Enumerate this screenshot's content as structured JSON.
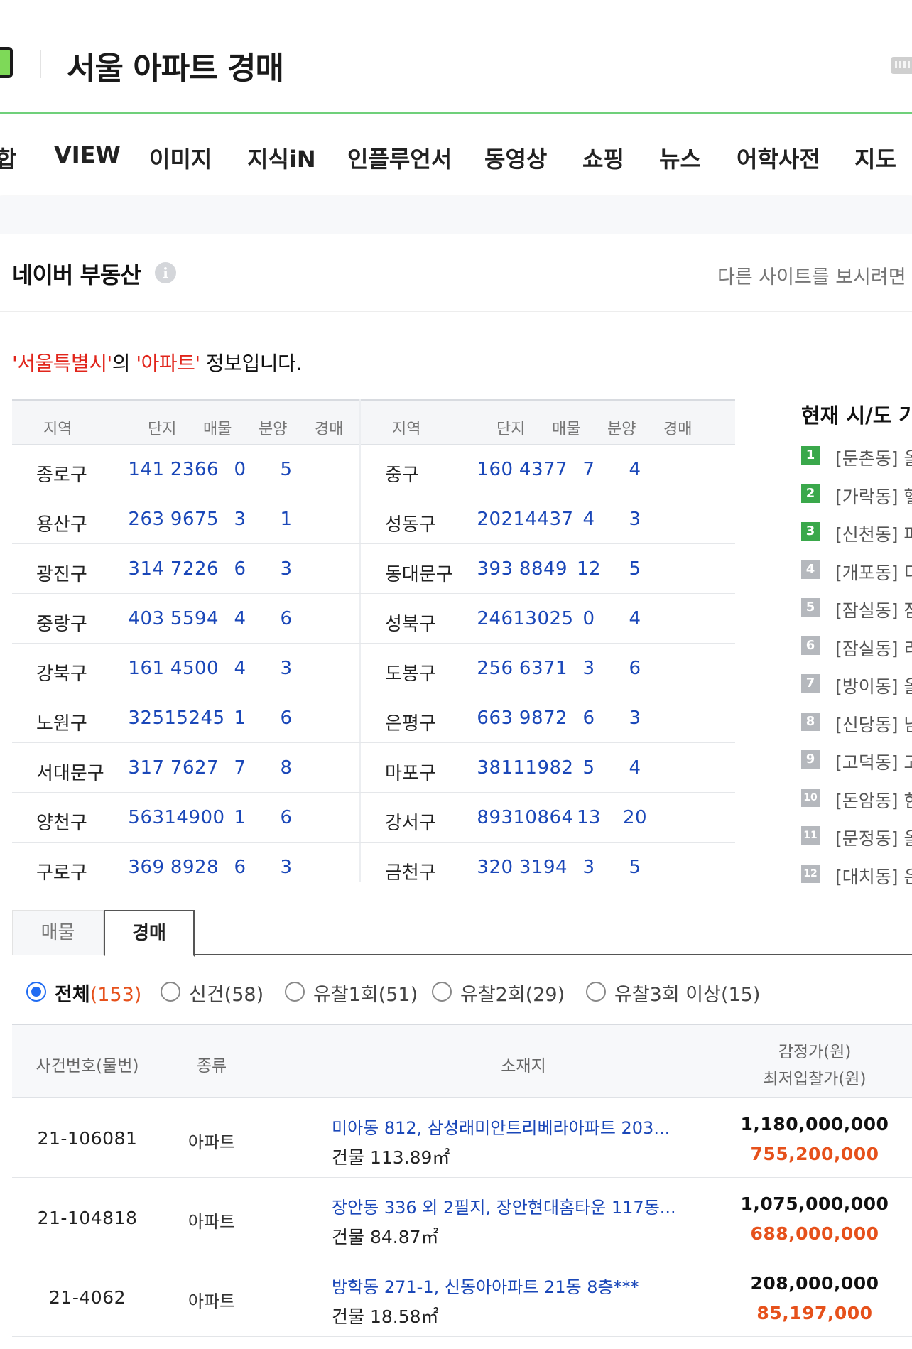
{
  "header": {
    "query": "서울 아파트 경매"
  },
  "tabs": [
    "합",
    "VIEW",
    "이미지",
    "지식iN",
    "인플루언서",
    "동영상",
    "쇼핑",
    "뉴스",
    "어학사전",
    "지도"
  ],
  "section": {
    "title": "네이버 부동산",
    "info": "i",
    "right_hint": "다른 사이트를 보시려면 클"
  },
  "intro": {
    "city": "'서울특별시'",
    "mid": "의 ",
    "type": "'아파트'",
    "tail": " 정보입니다."
  },
  "region_table": {
    "headers": [
      "지역",
      "단지",
      "매물",
      "분양",
      "경매"
    ],
    "rows": [
      [
        [
          "종로구",
          "141",
          "2366",
          "0",
          "5"
        ],
        [
          "중구",
          "160",
          "4377",
          "7",
          "4"
        ]
      ],
      [
        [
          "용산구",
          "263",
          "9675",
          "3",
          "1"
        ],
        [
          "성동구",
          "202",
          "14437",
          "4",
          "3"
        ]
      ],
      [
        [
          "광진구",
          "314",
          "7226",
          "6",
          "3"
        ],
        [
          "동대문구",
          "393",
          "8849",
          "12",
          "5"
        ]
      ],
      [
        [
          "중랑구",
          "403",
          "5594",
          "4",
          "6"
        ],
        [
          "성북구",
          "246",
          "13025",
          "0",
          "4"
        ]
      ],
      [
        [
          "강북구",
          "161",
          "4500",
          "4",
          "3"
        ],
        [
          "도봉구",
          "256",
          "6371",
          "3",
          "6"
        ]
      ],
      [
        [
          "노원구",
          "325",
          "15245",
          "1",
          "6"
        ],
        [
          "은평구",
          "663",
          "9872",
          "6",
          "3"
        ]
      ],
      [
        [
          "서대문구",
          "317",
          "7627",
          "7",
          "8"
        ],
        [
          "마포구",
          "381",
          "11982",
          "5",
          "4"
        ]
      ],
      [
        [
          "양천구",
          "563",
          "14900",
          "1",
          "6"
        ],
        [
          "강서구",
          "893",
          "10864",
          "13",
          "20"
        ]
      ],
      [
        [
          "구로구",
          "369",
          "8928",
          "6",
          "3"
        ],
        [
          "금천구",
          "320",
          "3194",
          "3",
          "5"
        ]
      ]
    ]
  },
  "ranking": {
    "title": "현재 시/도 가",
    "items": [
      {
        "num": "1",
        "text": "[둔촌동] 올",
        "color": "#3aa84b"
      },
      {
        "num": "2",
        "text": "[가락동] 헬",
        "color": "#3aa84b"
      },
      {
        "num": "3",
        "text": "[신천동] 파",
        "color": "#3aa84b"
      },
      {
        "num": "4",
        "text": "[개포동] 디",
        "color": "#b5b8bd"
      },
      {
        "num": "5",
        "text": "[잠실동] 잠",
        "color": "#b5b8bd"
      },
      {
        "num": "6",
        "text": "[잠실동] 리",
        "color": "#b5b8bd"
      },
      {
        "num": "7",
        "text": "[방이동] 올",
        "color": "#b5b8bd"
      },
      {
        "num": "8",
        "text": "[신당동] 남",
        "color": "#b5b8bd"
      },
      {
        "num": "9",
        "text": "[고덕동] 고",
        "color": "#b5b8bd"
      },
      {
        "num": "10",
        "text": "[돈암동] 한",
        "color": "#b5b8bd"
      },
      {
        "num": "11",
        "text": "[문정동] 올",
        "color": "#b5b8bd"
      },
      {
        "num": "12",
        "text": "[대치동] 은",
        "color": "#b5b8bd"
      }
    ]
  },
  "auction_tabs": {
    "listing": "매물",
    "auction": "경매",
    "selected": "경매"
  },
  "filters": [
    {
      "label": "전체",
      "count": "(153)",
      "selected": true
    },
    {
      "label": "신건(58)",
      "count": "",
      "selected": false
    },
    {
      "label": "유찰1회(51)",
      "count": "",
      "selected": false
    },
    {
      "label": "유찰2회(29)",
      "count": "",
      "selected": false
    },
    {
      "label": "유찰3회 이상(15)",
      "count": "",
      "selected": false
    }
  ],
  "auction_table": {
    "headers": {
      "case": "사건번호(물번)",
      "type": "종류",
      "address": "소재지",
      "price1": "감정가(원)",
      "price2": "최저입찰가(원)"
    },
    "rows": [
      {
        "case": "21-106081",
        "type": "아파트",
        "address": "미아동 812, 삼성래미안트리베라아파트 203...",
        "area": "건물 113.89㎡",
        "appraisal": "1,180,000,000",
        "minimum": "755,200,000"
      },
      {
        "case": "21-104818",
        "type": "아파트",
        "address": "장안동 336 외 2필지, 장안현대홈타운 117동...",
        "area": "건물 84.87㎡",
        "appraisal": "1,075,000,000",
        "minimum": "688,000,000"
      },
      {
        "case": "21-4062",
        "type": "아파트",
        "address": "방학동 271-1, 신동아아파트 21동 8층***",
        "area": "건물 18.58㎡",
        "appraisal": "208,000,000",
        "minimum": "85,197,000"
      }
    ]
  },
  "colors": {
    "accent_green": "#6fd07a",
    "link_blue": "#1a47b8",
    "price_orange": "#e6511b",
    "radio_blue": "#1f6bf2"
  }
}
